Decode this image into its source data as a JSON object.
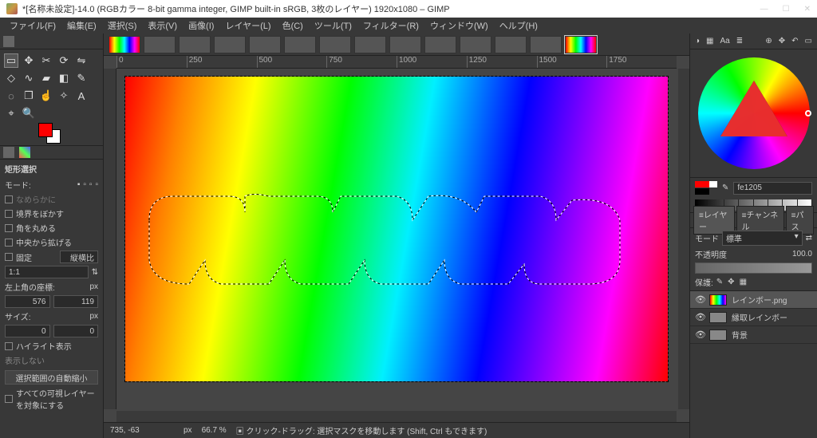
{
  "title": "*[名称未設定]-14.0 (RGBカラー 8-bit gamma integer, GIMP built-in sRGB, 3枚のレイヤー) 1920x1080 – GIMP",
  "menus": [
    "ファイル(F)",
    "編集(E)",
    "選択(S)",
    "表示(V)",
    "画像(I)",
    "レイヤー(L)",
    "色(C)",
    "ツール(T)",
    "フィルター(R)",
    "ウィンドウ(W)",
    "ヘルプ(H)"
  ],
  "ruler_ticks": [
    "0",
    "250",
    "500",
    "750",
    "1000",
    "1250",
    "1500",
    "1750"
  ],
  "tool_options": {
    "title": "矩形選択",
    "mode_label": "モード:",
    "antialias": "なめらかに",
    "feather": "境界をぼかす",
    "rounded": "角を丸める",
    "expand": "中央から拡げる",
    "fixed_label": "固定",
    "fixed_value": "縦横比",
    "ratio": "1:1",
    "pos_label": "左上角の座標:",
    "pos_unit": "px",
    "pos_x": "576",
    "pos_y": "119",
    "size_label": "サイズ:",
    "size_unit": "px",
    "size_w": "0",
    "size_h": "0",
    "highlight": "ハイライト表示",
    "no_display": "表示しない",
    "autoshrink": "選択範囲の自動縮小",
    "all_layers": "すべての可視レイヤーを対象にする"
  },
  "status": {
    "coords": "735, -63",
    "unit": "px",
    "zoom": "66.7 %",
    "hint": "クリック-ドラッグ: 選択マスクを移動します (Shift, Ctrl もできます)"
  },
  "color_hex": "fe1205",
  "layer_panel": {
    "tabs": [
      "レイヤー",
      "チャンネル",
      "パス"
    ],
    "mode_label": "モード",
    "mode_value": "標準",
    "opacity_label": "不透明度",
    "opacity_value": "100.0",
    "lock_label": "保護:"
  },
  "layers": [
    {
      "name": "レインボー.png",
      "visible": true,
      "active": true,
      "rainbow": true
    },
    {
      "name": "縁取レインボー",
      "visible": true,
      "active": false,
      "rainbow": false
    },
    {
      "name": "背景",
      "visible": true,
      "active": false,
      "rainbow": false
    }
  ]
}
